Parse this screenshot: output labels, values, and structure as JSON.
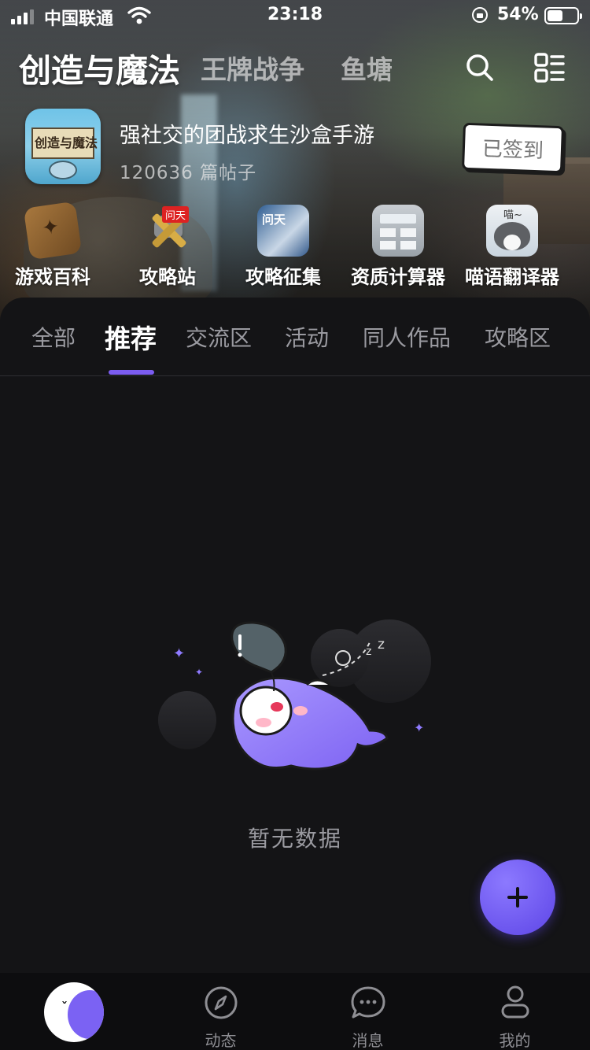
{
  "status_bar": {
    "carrier": "中国联通",
    "time": "23:18",
    "battery_percent": "54%",
    "battery_level": 0.54,
    "signal_bars": 3
  },
  "top_nav": {
    "active": "创造与魔法",
    "others": [
      "王牌战争",
      "鱼塘"
    ],
    "icons": [
      "search-icon",
      "menu-grid-icon"
    ]
  },
  "game": {
    "icon_text": "创造与魔法",
    "subtitle": "强社交的团战求生沙盒手游",
    "posts": "120636 篇帖子",
    "checkin_label": "已签到"
  },
  "tools": [
    {
      "label": "游戏百科",
      "icon": "encyclopedia-book-icon"
    },
    {
      "label": "攻略站",
      "icon": "guide-station-icon",
      "badge": "问天"
    },
    {
      "label": "攻略征集",
      "icon": "guide-collection-icon"
    },
    {
      "label": "资质计算器",
      "icon": "calculator-icon"
    },
    {
      "label": "喵语翻译器",
      "icon": "cat-translator-icon",
      "badge": "喵~"
    }
  ],
  "tabs": [
    "全部",
    "推荐",
    "交流区",
    "活动",
    "同人作品",
    "攻略区"
  ],
  "active_tab": "推荐",
  "empty_state": {
    "text": "暂无数据",
    "illustration": "sleeping-fish-mascot"
  },
  "fab": {
    "icon": "plus-icon"
  },
  "bottom_nav": [
    {
      "label": "",
      "icon": "home-mascot-icon"
    },
    {
      "label": "动态",
      "icon": "compass-icon"
    },
    {
      "label": "消息",
      "icon": "chat-bubble-icon"
    },
    {
      "label": "我的",
      "icon": "profile-icon"
    }
  ],
  "colors": {
    "accent": "#7b5cf0",
    "background": "#141416"
  }
}
